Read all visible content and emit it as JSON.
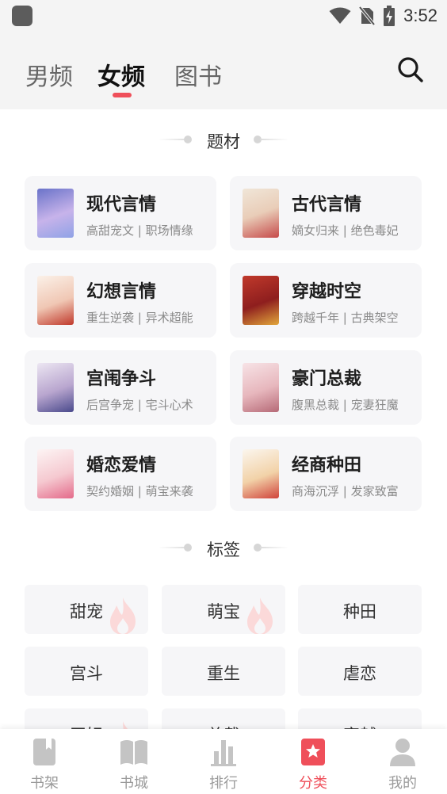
{
  "status_bar": {
    "time": "3:52"
  },
  "header": {
    "tabs": [
      {
        "label": "男频",
        "active": false
      },
      {
        "label": "女频",
        "active": true
      },
      {
        "label": "图书",
        "active": false
      }
    ],
    "search_icon": "search-icon",
    "accent_color": "#ef4f5a"
  },
  "genres_section": {
    "title": "题材",
    "items": [
      {
        "title": "现代言情",
        "subtitle": "高甜宠文 | 职场情缘"
      },
      {
        "title": "古代言情",
        "subtitle": "嫡女归来 | 绝色毒妃"
      },
      {
        "title": "幻想言情",
        "subtitle": "重生逆袭 | 异术超能"
      },
      {
        "title": "穿越时空",
        "subtitle": "跨越千年 | 古典架空"
      },
      {
        "title": "宫闱争斗",
        "subtitle": "后宫争宠 | 宅斗心术"
      },
      {
        "title": "豪门总裁",
        "subtitle": "腹黑总裁 | 宠妻狂魔"
      },
      {
        "title": "婚恋爱情",
        "subtitle": "契约婚姻 | 萌宝来袭"
      },
      {
        "title": "经商种田",
        "subtitle": "商海沉浮 | 发家致富"
      }
    ]
  },
  "tags_section": {
    "title": "标签",
    "items": [
      {
        "label": "甜宠",
        "hot": true
      },
      {
        "label": "萌宝",
        "hot": true
      },
      {
        "label": "种田",
        "hot": false
      },
      {
        "label": "宫斗",
        "hot": false
      },
      {
        "label": "重生",
        "hot": false
      },
      {
        "label": "虐恋",
        "hot": false
      },
      {
        "label": "王妃",
        "hot": true
      },
      {
        "label": "总裁",
        "hot": false
      },
      {
        "label": "穿越",
        "hot": false
      }
    ]
  },
  "bottom_nav": {
    "items": [
      {
        "label": "书架",
        "icon": "bookshelf-icon",
        "active": false
      },
      {
        "label": "书城",
        "icon": "book-open-icon",
        "active": false
      },
      {
        "label": "排行",
        "icon": "bar-chart-icon",
        "active": false
      },
      {
        "label": "分类",
        "icon": "category-star-icon",
        "active": true
      },
      {
        "label": "我的",
        "icon": "user-icon",
        "active": false
      }
    ]
  }
}
